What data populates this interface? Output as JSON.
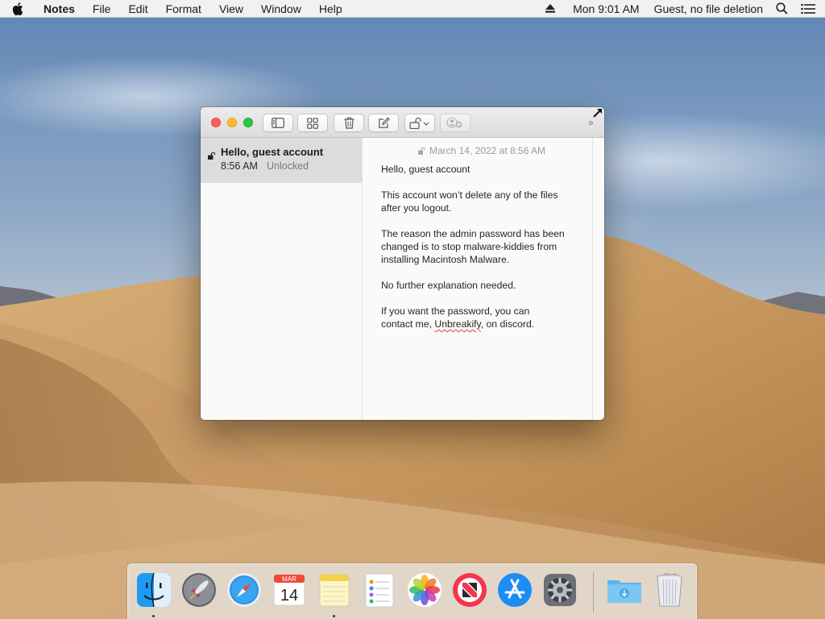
{
  "menubar": {
    "apple_icon": "apple-icon",
    "app_name": "Notes",
    "menus": [
      "File",
      "Edit",
      "Format",
      "View",
      "Window",
      "Help"
    ],
    "eject_icon": "eject-icon",
    "clock": "Mon 9:01 AM",
    "user": "Guest, no file deletion",
    "search_icon": "magnifier-icon",
    "notification_icon": "list-icon"
  },
  "window": {
    "app": "Notes",
    "toolbar": {
      "buttons": [
        "sidebar-toggle",
        "gallery-view",
        "delete-note",
        "new-note",
        "lock-note",
        "add-people"
      ],
      "overflow": "»"
    },
    "notes": [
      {
        "title": "Hello, guest account",
        "time": "8:56 AM",
        "status": "Unlocked"
      }
    ],
    "editor": {
      "date": "March 14, 2022 at 8:56 AM",
      "paragraphs": [
        [
          "Hello, guest account"
        ],
        [
          "This account won’t delete any of the files",
          "after you logout."
        ],
        [
          "The reason the admin password has been",
          "changed is to stop malware-kiddies from",
          "installing Macintosh Malware."
        ],
        [
          "No further explanation needed."
        ],
        [
          "If you want the password, you can",
          "contact me, "
        ]
      ],
      "misspelled_word": "Unbreakify",
      "tail_text": ", on discord."
    }
  },
  "dock": {
    "apps": [
      {
        "name": "Finder",
        "icon": "finder-icon",
        "running": true
      },
      {
        "name": "Launchpad",
        "icon": "launchpad-icon",
        "running": false
      },
      {
        "name": "Safari",
        "icon": "safari-icon",
        "running": false
      },
      {
        "name": "Calendar",
        "icon": "calendar-icon",
        "running": false,
        "month": "MAR",
        "day": "14"
      },
      {
        "name": "Notes",
        "icon": "notes-icon",
        "running": true
      },
      {
        "name": "Reminders",
        "icon": "reminders-icon",
        "running": false
      },
      {
        "name": "Photos",
        "icon": "photos-icon",
        "running": false
      },
      {
        "name": "News",
        "icon": "news-icon",
        "running": false
      },
      {
        "name": "App Store",
        "icon": "app-store-icon",
        "running": false
      },
      {
        "name": "System Preferences",
        "icon": "system-preferences-icon",
        "running": false
      },
      {
        "name": "Downloads",
        "icon": "downloads-folder-icon",
        "running": false
      },
      {
        "name": "Trash",
        "icon": "trash-icon",
        "running": false
      }
    ]
  },
  "colors": {
    "close": "#fe5f57",
    "minimize": "#febc2e",
    "zoom": "#28c840",
    "selection": "#dcdcdc",
    "spelling": "#e0413a"
  }
}
